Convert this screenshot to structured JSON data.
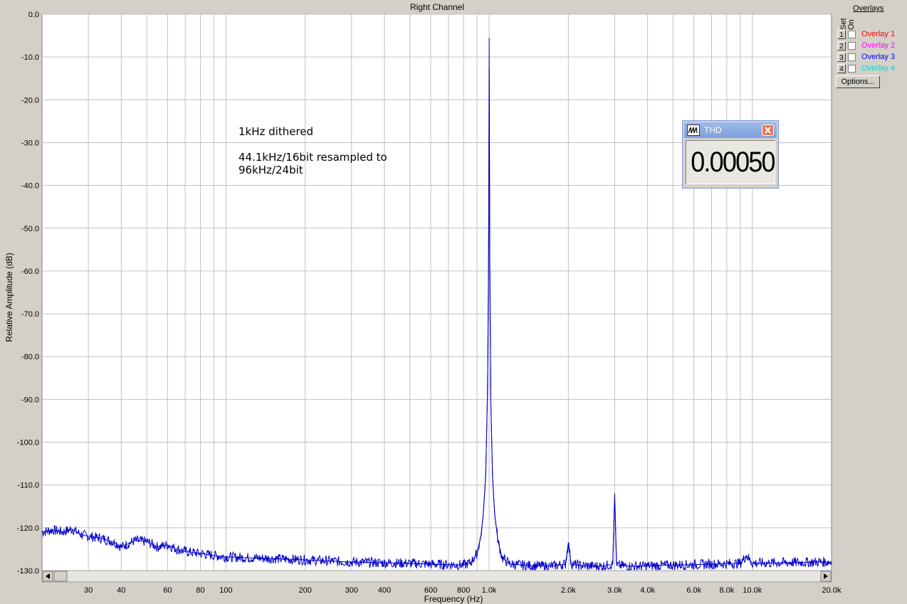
{
  "colors": {
    "trace": "#0000c8",
    "grid": "#c0c0c0",
    "plot_bg": "#ffffff",
    "window_bg": "#d4d0c8"
  },
  "chart_data": {
    "type": "line",
    "title": "Right Channel",
    "xlabel": "Frequency (Hz)",
    "ylabel": "Relative Amplitude (dB)",
    "xscale": "log",
    "xlim": [
      20,
      20000
    ],
    "ylim": [
      -130,
      0
    ],
    "grid": true,
    "x_ticks": [
      30,
      40,
      60,
      80,
      100,
      200,
      300,
      400,
      600,
      800,
      1000,
      2000,
      3000,
      4000,
      6000,
      8000,
      10000,
      20000
    ],
    "x_tick_labels": [
      "30",
      "40",
      "60",
      "80",
      "100",
      "200",
      "300",
      "400",
      "600",
      "800",
      "1.0k",
      "2.0k",
      "3.0k",
      "4.0k",
      "6.0k",
      "8.0k",
      "10.0k",
      "20.0k"
    ],
    "y_ticks": [
      0,
      -10,
      -20,
      -30,
      -40,
      -50,
      -60,
      -70,
      -80,
      -90,
      -100,
      -110,
      -120,
      -130
    ],
    "y_tick_labels": [
      "0.0",
      "-10.0",
      "-20.0",
      "-30.0",
      "-40.0",
      "-50.0",
      "-60.0",
      "-70.0",
      "-80.0",
      "-90.0",
      "-100.0",
      "-110.0",
      "-120.0",
      "-130.0"
    ],
    "annotations": [
      "1kHz dithered",
      "44.1kHz/16bit resampled to",
      "96kHz/24bit"
    ],
    "series": [
      {
        "x": [
          20,
          22,
          24,
          26,
          28,
          30,
          34,
          38,
          40,
          45,
          50,
          55,
          60,
          65,
          70,
          75,
          80,
          90,
          100,
          120,
          150,
          200,
          300,
          400,
          500,
          600,
          700,
          800,
          850,
          900,
          930,
          950,
          970,
          985,
          995,
          1000,
          1005,
          1015,
          1030,
          1050,
          1080,
          1120,
          1200,
          1400,
          1700,
          1950,
          2000,
          2050,
          2300,
          2700,
          2950,
          3000,
          3050,
          3500,
          4000,
          5000,
          6000,
          7000,
          8000,
          9000,
          9500,
          10000,
          12000,
          15000,
          18000,
          20000
        ],
        "y": [
          -121,
          -120.5,
          -121,
          -120.3,
          -121.5,
          -122,
          -122.5,
          -123.5,
          -124.5,
          -123,
          -123.2,
          -124.5,
          -124,
          -125,
          -125.5,
          -125.8,
          -126,
          -126.5,
          -126.8,
          -127,
          -127.2,
          -127.5,
          -128,
          -128.2,
          -128.3,
          -128.5,
          -128.6,
          -128.7,
          -128.2,
          -126,
          -122,
          -117,
          -108,
          -90,
          -60,
          -5.5,
          -55,
          -90,
          -108,
          -117,
          -123,
          -127,
          -128.5,
          -128.8,
          -129,
          -128.5,
          -123.5,
          -128.5,
          -128.9,
          -129,
          -128.5,
          -112,
          -128.8,
          -129,
          -128.9,
          -128.7,
          -128.6,
          -128.5,
          -128.4,
          -128.3,
          -126.5,
          -128.3,
          -128.2,
          -128.1,
          -128,
          -128
        ]
      }
    ]
  },
  "overlays": {
    "title": "Overlays",
    "set_label": "Set",
    "on_label": "On",
    "items": [
      {
        "num": "1",
        "label": "Overlay 1",
        "color": "#ff0000"
      },
      {
        "num": "2",
        "label": "Overlay 2",
        "color": "#ff00ff"
      },
      {
        "num": "3",
        "label": "Overlay 3",
        "color": "#0000ff"
      },
      {
        "num": "4",
        "label": "Overlay 4",
        "color": "#00e0e0"
      }
    ],
    "options_label": "Options..."
  },
  "thd": {
    "title": "THD",
    "value": "0.00050 %"
  },
  "icons": {
    "thd_window": "waveform-icon",
    "close": "close-icon",
    "scroll_left": "arrow-left-icon",
    "scroll_right": "arrow-right-icon"
  }
}
